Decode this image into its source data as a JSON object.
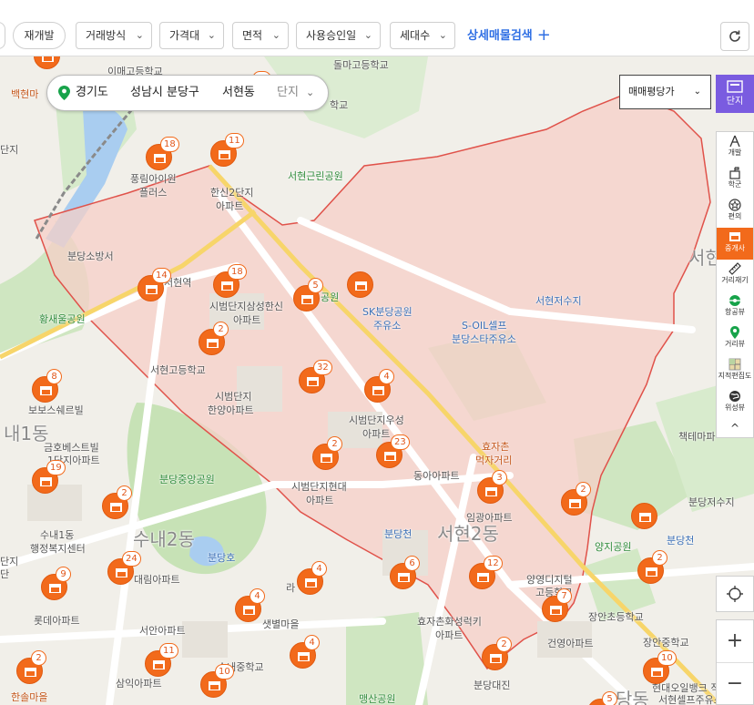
{
  "filters": {
    "redevelop": "재개발",
    "trade_type": "거래방식",
    "price": "가격대",
    "area": "면적",
    "approval_date": "사용승인일",
    "households": "세대수",
    "detail_search": "상세매물검색",
    "chevron": "⌄"
  },
  "location": {
    "province": "경기도",
    "city": "성남시 분당구",
    "dong": "서현동",
    "complex_placeholder": "단지"
  },
  "price_type": {
    "selected": "매매평당가"
  },
  "rail": {
    "top_label": "단지",
    "items": [
      {
        "label": "개발",
        "icon": "development-icon"
      },
      {
        "label": "학군",
        "icon": "school-district-icon"
      },
      {
        "label": "편의",
        "icon": "convenience-icon"
      },
      {
        "label": "중개사",
        "icon": "agent-icon",
        "active": true
      },
      {
        "label": "거리재기",
        "icon": "ruler-icon"
      },
      {
        "label": "항공뷰",
        "icon": "aerial-view-icon"
      },
      {
        "label": "거리뷰",
        "icon": "street-view-icon"
      },
      {
        "label": "지적편집도",
        "icon": "cadastral-icon"
      },
      {
        "label": "위성뷰",
        "icon": "satellite-icon"
      }
    ],
    "collapse": "^",
    "zoom_in": "+",
    "zoom_out": "−"
  },
  "colors": {
    "marker": "#f26a1b",
    "district_fill": "#f7c9c2",
    "district_border": "#e0524a",
    "accent_blue": "#2f6fe4",
    "rail_purple": "#7a5ce0"
  },
  "map_labels": {
    "baekhyeon": "백현마",
    "imae_school": "이매고등학교",
    "dolma_school": "돌마고등학교",
    "hakgyo": "학교",
    "danji_left": "단지",
    "pungrim": "풍림아이원",
    "plaza": "플러스",
    "hanshin2": "한신2단지",
    "apt": "아파트",
    "seohyeon_park": "서현근린공원",
    "fire_station": "분당소방서",
    "seohyeon_station": "서현역",
    "sibeom_samsung": "시범단지삼성한신",
    "park_short": "원",
    "sk_gas": "SK분당공원",
    "gas_station": "주유소",
    "soil": "S-OIL셀프",
    "bundang_star": "분당스타주유소",
    "seohyeon_reservoir": "서현저수지",
    "seohyeon_big": "서현",
    "hwangsaeul": "황새울공원",
    "seohyeon_high": "서현고등학교",
    "sibeom_hanyang": "시범단지",
    "hanyang_apt": "한양아파트",
    "bobo": "보보스쉐르빌",
    "sunae1": "내1동",
    "geumho": "금호베스트빌",
    "geumho2": "1단지아파트",
    "sibeom_woosung": "시범단지우성",
    "woosung_apt": "아파트",
    "hyojachon": "효자촌",
    "food_street": "먹자거리",
    "tekteamal": "책테마파",
    "bundang_central": "분당중앙공원",
    "sibeom_hyundai": "시범단지현대",
    "hyundai_apt": "아파트",
    "donga": "동아아파트",
    "imgwang": "임광아파트",
    "sunae2": "수내2동",
    "seohyeon2": "서현2동",
    "bundangcheon": "분당천",
    "bundangcheon2": "분당천",
    "sunae1_center": "수내1동",
    "admin_center": "행정복지센터",
    "bundang_lake": "분당호",
    "daerim": "대림아파트",
    "yangji_park": "양지공원",
    "yangyoung": "양영디지털",
    "high_school": "고등학교",
    "jangan_elem": "장안초등학교",
    "lotte": "롯데아파트",
    "hyoja_hwaseong": "효자촌화성럭키",
    "hyoja_apt": "아파트",
    "seoan": "서안아파트",
    "sunae_high": "수내중학교",
    "saetbyeol": "샛별마을",
    "geonyoung": "건영아파트",
    "jangan_middle": "장안중학교",
    "hyundai_bank": "현대오일뱅크 직",
    "samik": "삼익아파트",
    "hansol": "한솔마을",
    "maengsan": "맹산공원",
    "bundang_daejin": "분당대진",
    "seohyeon_gas": "서현셀프주유소",
    "bundang_reservoir": "분당저수지",
    "bundangdong": "당동",
    "danji_left2": "단지",
    "apt_left": "아파트",
    "gwa": "라",
    "row_left": "단"
  },
  "markers": [
    {
      "count": "10"
    },
    {
      "count": "18"
    },
    {
      "count": "11"
    },
    {
      "count": "14"
    },
    {
      "count": "18"
    },
    {
      "count": "5"
    },
    {
      "count": "2"
    },
    {
      "count": "32"
    },
    {
      "count": "4"
    },
    {
      "count": "8"
    },
    {
      "count": "2"
    },
    {
      "count": "23"
    },
    {
      "count": "19"
    },
    {
      "count": "3"
    },
    {
      "count": "2"
    },
    {
      "count": "2"
    },
    {
      "count": "24"
    },
    {
      "count": "9"
    },
    {
      "count": "6"
    },
    {
      "count": "12"
    },
    {
      "count": "4"
    },
    {
      "count": "4"
    },
    {
      "count": "7"
    },
    {
      "count": "2"
    },
    {
      "count": "2"
    },
    {
      "count": "11"
    },
    {
      "count": "4"
    },
    {
      "count": "2"
    },
    {
      "count": "10"
    },
    {
      "count": "10"
    },
    {
      "count": "5"
    },
    {
      "count": ""
    },
    {
      "count": ""
    },
    {
      "count": ""
    }
  ]
}
